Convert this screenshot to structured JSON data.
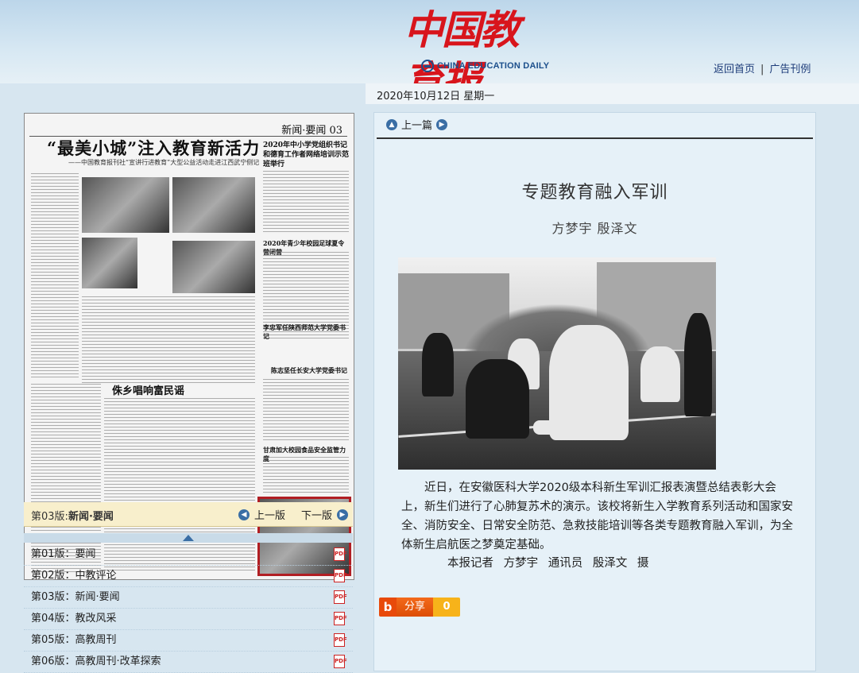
{
  "masthead": {
    "logo_cn": "中国教育报",
    "logo_en": "CHINA EDUCATION DAILY",
    "links": [
      "返回首页",
      "广告刊例"
    ]
  },
  "date": "2020年10月12日  星期一",
  "thumbnail": {
    "section": "新闻·要闻 03",
    "headline": "“最美小城”注入教育新活力",
    "subheadline": "——中国教育报刊社“宣讲行进教育”大型公益活动走进江西武宁侧记",
    "side_headline_1": "2020年中小学党组织书记和德育工作者网络培训示范班举行",
    "side_headline_2": "2020年青少年校园足球夏令营闭营",
    "side_headline_3": "李忠军任陕西师范大学党委书记",
    "side_headline_4": "陈志坚任长安大学党委书记",
    "side_headline_5": "甘肃加大校园食品安全监管力度",
    "mid_headline": "侏乡唱响富民谣"
  },
  "page_nav": {
    "label_prefix": "第03版:",
    "label_name": "新闻·要闻",
    "prev": "上一版",
    "next": "下一版"
  },
  "editions": [
    {
      "label": "第01版：要闻"
    },
    {
      "label": "第02版：中教评论"
    },
    {
      "label": "第03版：新闻·要闻"
    },
    {
      "label": "第04版：教改风采"
    },
    {
      "label": "第05版：高教周刊"
    },
    {
      "label": "第06版：高教周刊·改革探索"
    }
  ],
  "article": {
    "prev_link": "上一篇",
    "title": "专题教育融入军训",
    "author": "方梦宇  殷泽文",
    "body": "近日，在安徽医科大学2020级本科新生军训汇报表演暨总结表彰大会上，新生们进行了心肺复苏术的演示。该校将新生入学教育系列活动和国家安全、消防安全、日常安全防范、急救技能培训等各类专题教育融入军训，为全体新生启航医之梦奠定基础。",
    "credit": "本报记者  方梦宇  通讯员  殷泽文  摄"
  },
  "share": {
    "logo": "b",
    "label": "分享",
    "count": "0"
  }
}
